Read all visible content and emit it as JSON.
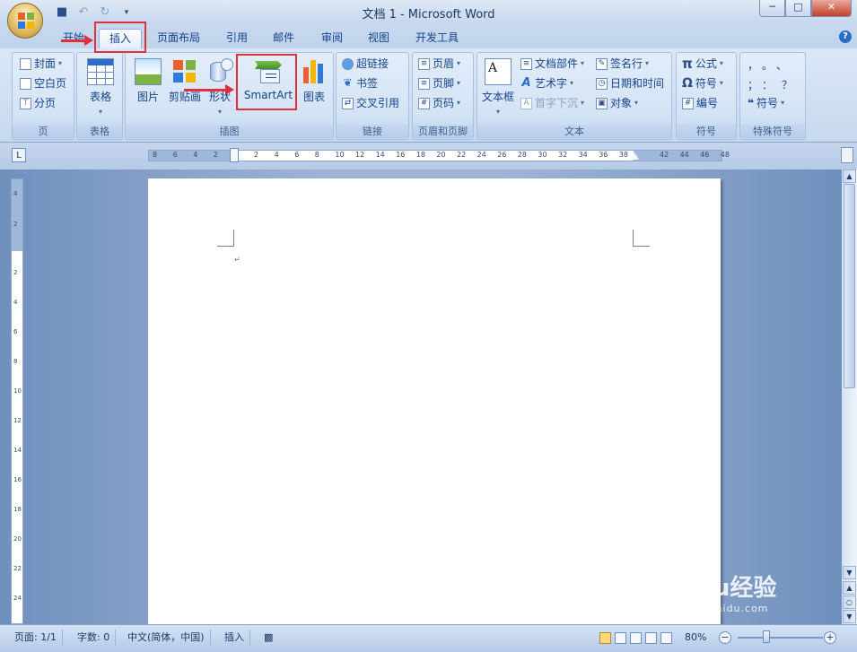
{
  "window": {
    "title": "文档 1 - Microsoft Word"
  },
  "qat": {
    "save": "save-icon",
    "undo": "undo-icon",
    "redo": "redo-icon",
    "customize": "customize-qat-icon"
  },
  "tabs": [
    "开始",
    "插入",
    "页面布局",
    "引用",
    "邮件",
    "审阅",
    "视图",
    "开发工具"
  ],
  "active_tab": "插入",
  "ribbon": {
    "pages": {
      "cover": "封面",
      "blank": "空白页",
      "break": "分页",
      "label": "页"
    },
    "tables": {
      "table": "表格",
      "label": "表格"
    },
    "illustrations": {
      "picture": "图片",
      "clipart": "剪贴画",
      "shapes": "形状",
      "smartart": "SmartArt",
      "chart": "图表",
      "label": "插图"
    },
    "links": {
      "hyperlink": "超链接",
      "bookmark": "书签",
      "crossref": "交叉引用",
      "label": "链接"
    },
    "header_footer": {
      "header": "页眉",
      "footer": "页脚",
      "page_number": "页码",
      "label": "页眉和页脚"
    },
    "text": {
      "textbox": "文本框",
      "quickparts": "文档部件",
      "wordart": "艺术字",
      "dropcap": "首字下沉",
      "signature": "签名行",
      "datetime": "日期和时间",
      "object": "对象",
      "label": "文本"
    },
    "symbols": {
      "equation": "公式",
      "symbol": "符号",
      "numbering": "编号",
      "label": "符号"
    },
    "special": {
      "row1": "，。、",
      "row2": "；：？",
      "more": "符号",
      "label": "特殊符号"
    }
  },
  "ruler": {
    "ticks": [
      "8",
      "6",
      "4",
      "2",
      "2",
      "4",
      "6",
      "8",
      "10",
      "12",
      "14",
      "16",
      "18",
      "20",
      "22",
      "24",
      "26",
      "28",
      "30",
      "32",
      "34",
      "36",
      "38",
      "42",
      "44",
      "46",
      "48"
    ]
  },
  "vruler": {
    "ticks": [
      "4",
      "2",
      "2",
      "4",
      "6",
      "8",
      "10",
      "12",
      "14",
      "16",
      "18",
      "20",
      "22",
      "24"
    ]
  },
  "status": {
    "page": "页面: 1/1",
    "words": "字数: 0",
    "language": "中文(简体，中国)",
    "mode": "插入",
    "zoom": "80%"
  },
  "watermark": {
    "brand": "Baidu经验",
    "url": "jingyan.baidu.com"
  },
  "colors": {
    "highlight": "#e0303a",
    "ribbon": "#dbe7f6",
    "tab_text": "#15428b"
  }
}
